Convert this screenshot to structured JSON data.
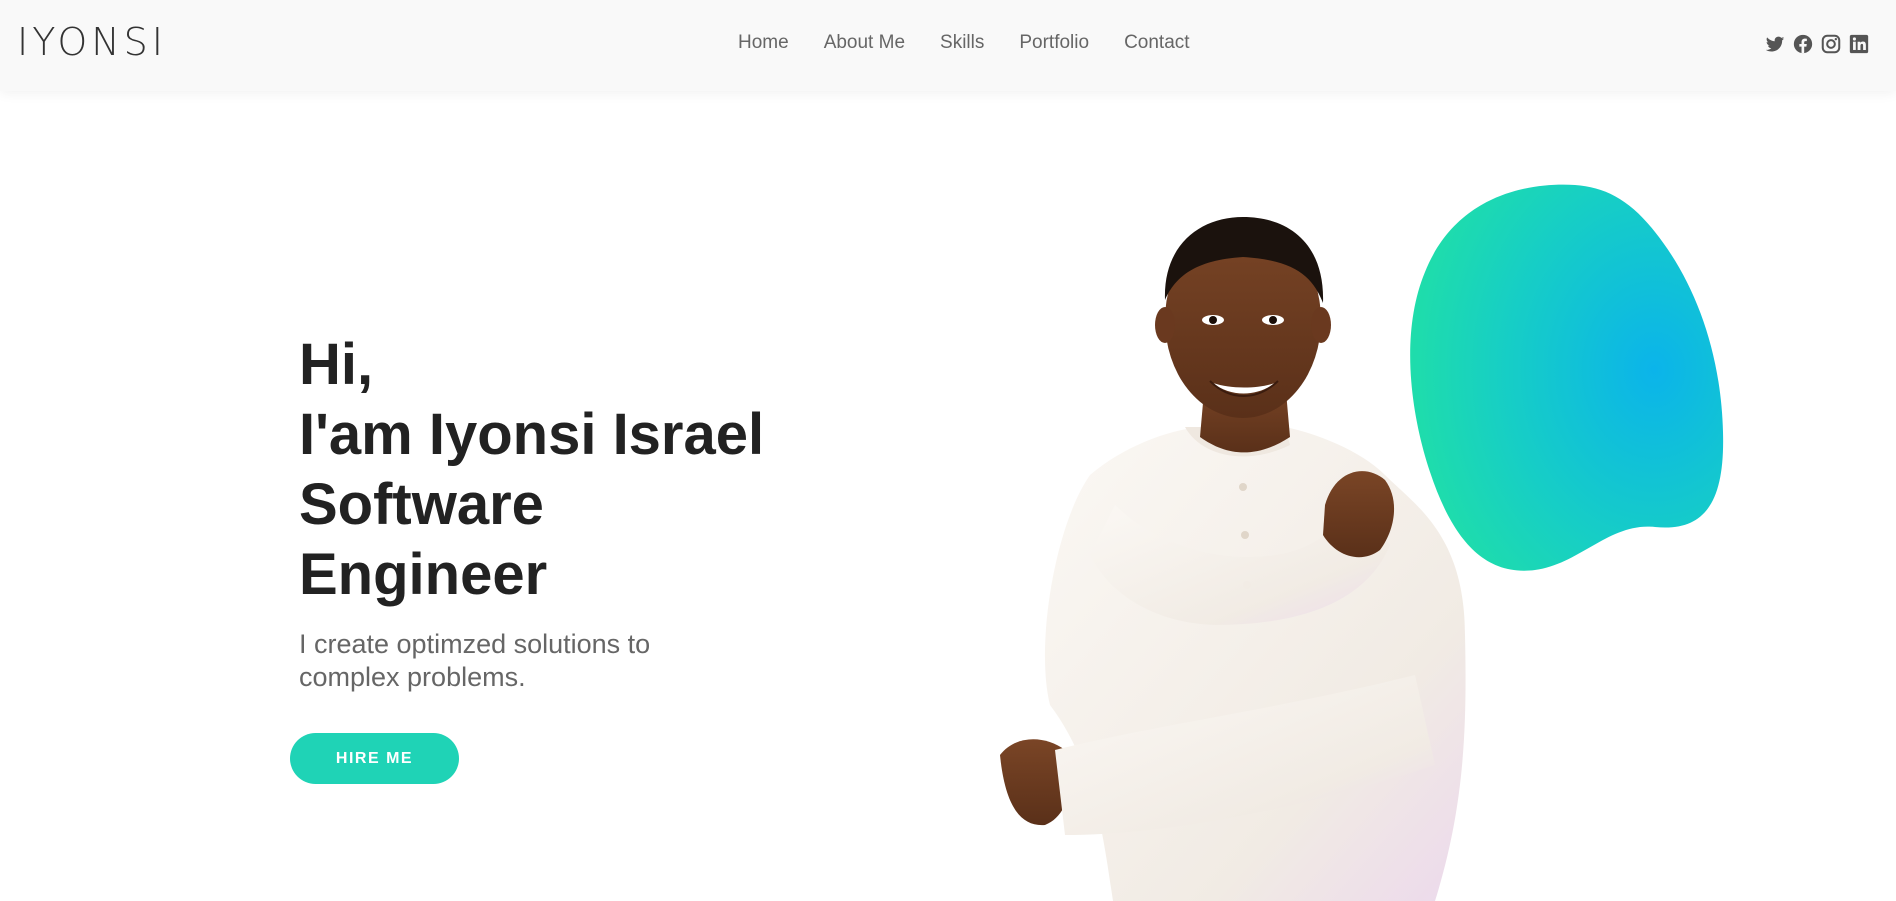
{
  "header": {
    "logo": "IYONSI",
    "nav": [
      {
        "label": "Home"
      },
      {
        "label": "About Me"
      },
      {
        "label": "Skills"
      },
      {
        "label": "Portfolio"
      },
      {
        "label": "Contact"
      }
    ],
    "social_icons": [
      "twitter-icon",
      "facebook-icon",
      "instagram-icon",
      "linkedin-icon"
    ]
  },
  "hero": {
    "greeting": "Hi,",
    "name_line": "I'am Iyonsi Israel",
    "role_line1": "Software",
    "role_line2": "Engineer",
    "tagline": "I create optimzed solutions to complex problems.",
    "cta_label": "HIRE ME"
  },
  "colors": {
    "accent": "#1fd3b6",
    "blob_start": "#22e3a0",
    "blob_end": "#0bb4ea",
    "heading": "#222222",
    "muted": "#666666"
  }
}
